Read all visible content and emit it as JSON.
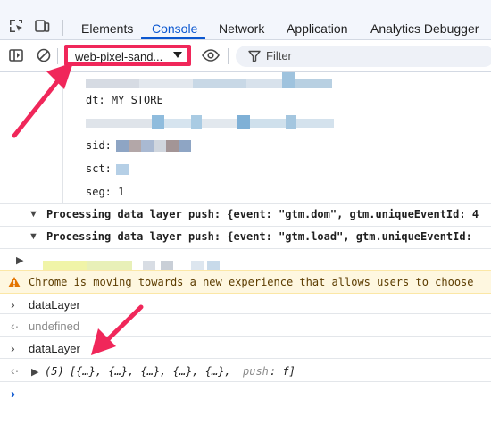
{
  "tabs": {
    "elements": "Elements",
    "console": "Console",
    "network": "Network",
    "application": "Application",
    "analytics": "Analytics Debugger"
  },
  "toolbar": {
    "context_label": "web-pixel-sand...",
    "filter_placeholder": "Filter"
  },
  "console": {
    "dt_line": "dt: MY STORE",
    "sid_label": "sid:",
    "sct_label": "sct:",
    "seg_line": "seg: 1",
    "push_dom": "Processing data layer push: {event: \"gtm.dom\", gtm.uniqueEventId: 4",
    "push_load": "Processing data layer push: {event: \"gtm.load\", gtm.uniqueEventId:",
    "warning": "Chrome is moving towards a new experience that allows users to choose",
    "input1": "dataLayer",
    "output1": "undefined",
    "input2": "dataLayer",
    "array_count": "(5)",
    "array_items": "[{…}, {…}, {…}, {…}, {…},",
    "push_key": "push",
    "push_val": ": f]"
  },
  "colors": {
    "accent": "#0b57d0",
    "annotation": "#f0275a",
    "warning_bg": "#fef7e0",
    "warning_icon": "#e37400"
  },
  "icons": [
    "inspect-icon",
    "device-toolbar-icon",
    "sidebar-icon",
    "clear-console-icon",
    "dropdown-caret-icon",
    "eye-icon",
    "filter-icon",
    "warning-icon",
    "expand-arrow-icon",
    "input-chevron-icon",
    "output-arrow-icon",
    "prompt-chevron-icon"
  ]
}
